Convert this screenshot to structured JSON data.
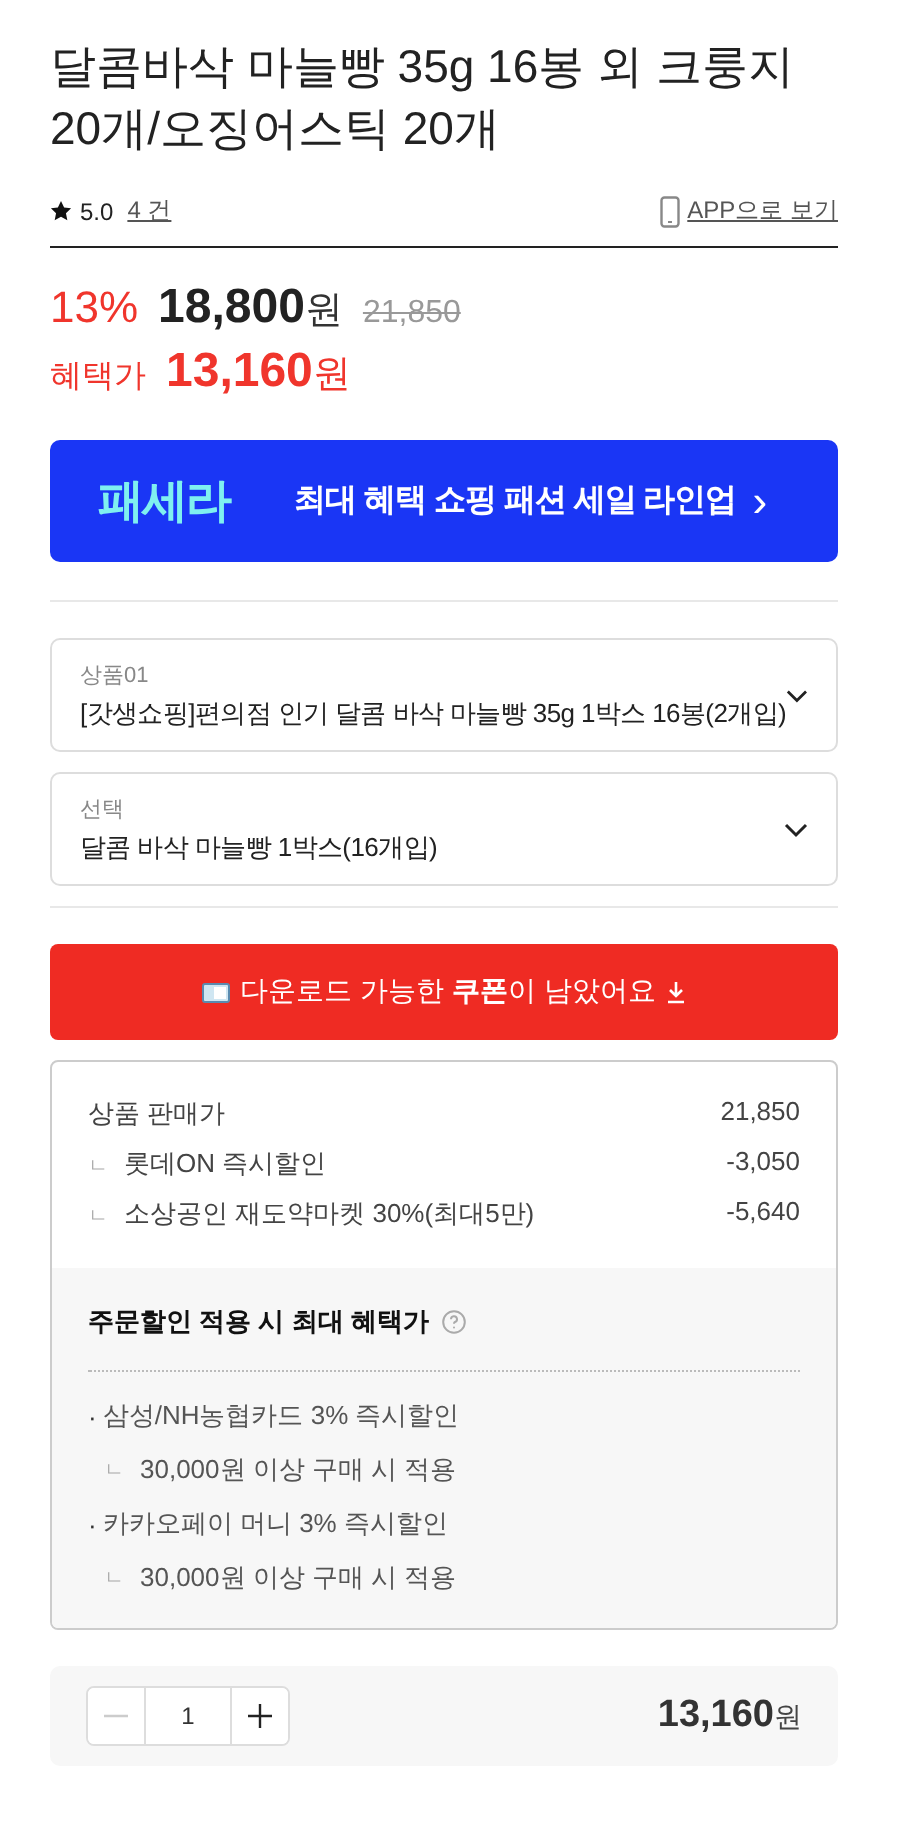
{
  "product": {
    "title": "달콤바삭 마늘빵 35g 16봉 외 크룽지 20개/오징어스틱 20개",
    "rating": "5.0",
    "review_count": "4 건",
    "app_link": "APP으로 보기"
  },
  "price": {
    "discount_rate": "13%",
    "sale_price": "18,800",
    "currency": "원",
    "original_price": "21,850",
    "benefit_label": "혜택가",
    "benefit_price": "13,160",
    "benefit_currency": "원"
  },
  "banner": {
    "logo": "패세라",
    "text": "최대 혜택 쇼핑 패션 세일 라인업",
    "chevron": "›"
  },
  "options": [
    {
      "label": "상품01",
      "value": "[갓생쇼핑]편의점 인기 달콤 바삭 마늘빵 35g 1박스 16봉(2개입)"
    },
    {
      "label": "선택",
      "value": "달콤 바삭 마늘빵 1박스(16개입)"
    }
  ],
  "coupon_button": {
    "text": "다운로드 가능한 **쿠폰**이 남았어요"
  },
  "summary": {
    "rows": [
      {
        "kind": "main",
        "label": "상품 판매가",
        "value": "21,850"
      },
      {
        "kind": "sub",
        "marker": "ㄴ",
        "label": "롯데ON 즉시할인",
        "value": "-3,050"
      },
      {
        "kind": "sub",
        "marker": "ㄴ",
        "label": "소상공인 재도약마켓 30%(최대5만)",
        "value": "-5,640"
      }
    ],
    "benefit_title": "주문할인 적용 시 최대 혜택가",
    "benefits": [
      {
        "kind": "bullet",
        "marker": "·",
        "text": "삼성/NH농협카드 3% 즉시할인"
      },
      {
        "kind": "sub",
        "marker": "ㄴ",
        "text": "30,000원 이상 구매 시 적용"
      },
      {
        "kind": "bullet",
        "marker": "·",
        "text": "카카오페이 머니 3% 즉시할인"
      },
      {
        "kind": "sub",
        "marker": "ㄴ",
        "text": "30,000원 이상 구매 시 적용"
      }
    ]
  },
  "quantity": {
    "value": "1",
    "decrease_disabled": true,
    "total": "13,160",
    "currency": "원"
  }
}
